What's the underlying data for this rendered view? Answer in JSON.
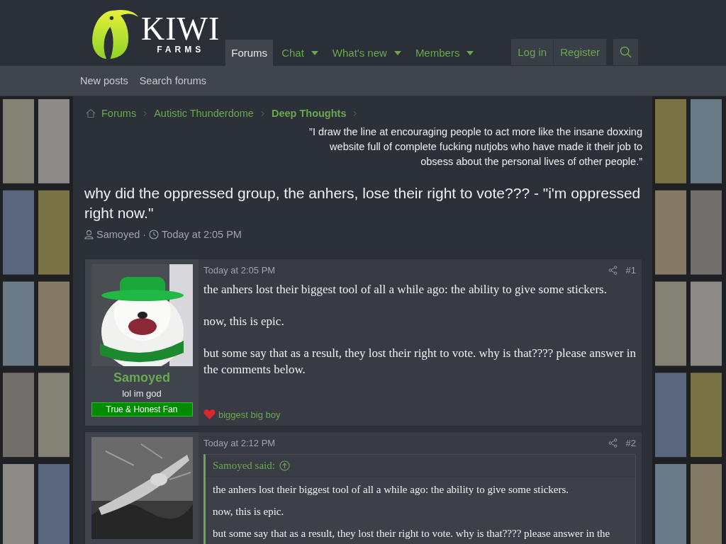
{
  "header": {
    "logo": {
      "word": "KIWI",
      "sub": "FARMS"
    },
    "nav": [
      {
        "label": "Forums",
        "selected": true,
        "dropdown": false
      },
      {
        "label": "Chat",
        "selected": false,
        "dropdown": true
      },
      {
        "label": "What's new",
        "selected": false,
        "dropdown": true
      },
      {
        "label": "Members",
        "selected": false,
        "dropdown": true
      }
    ],
    "account": [
      "Log in",
      "Register"
    ]
  },
  "subnav": [
    "New posts",
    "Search forums"
  ],
  "breadcrumbs": [
    {
      "label": "Forums",
      "current": false
    },
    {
      "label": "Autistic Thunderdome",
      "current": false
    },
    {
      "label": "Deep Thoughts",
      "current": true
    }
  ],
  "quote": "”I draw the line at encouraging people to act more like the insane doxxing website full of complete fucking nutjobs who have made it their job to obsess about the personal lives of other people.”",
  "thread": {
    "title": "why did the oppressed group, the anhers, lose their right to vote??? - \"i'm oppressed right now.\"",
    "author": "Samoyed",
    "separator": "·",
    "time": "Today at 2:05 PM"
  },
  "posts": [
    {
      "user": {
        "name": "Samoyed",
        "title": "lol im god",
        "banner": "True & Honest Fan"
      },
      "time": "Today at 2:05 PM",
      "number": "#1",
      "paragraphs": [
        "the anhers lost their biggest tool of all a while ago: the ability to give some stickers.",
        "now, this is epic.",
        "but some say that as a result, they lost their right to vote. why is that???? please answer in the comments below."
      ],
      "signature": "biggest big boy"
    },
    {
      "time": "Today at 2:12 PM",
      "number": "#2",
      "quote": {
        "author": "Samoyed said:",
        "paragraphs": [
          "the anhers lost their biggest tool of all a while ago: the ability to give some stickers.",
          "now, this is epic.",
          "but some say that as a result, they lost their right to vote. why is that???? please answer in the"
        ]
      }
    }
  ]
}
